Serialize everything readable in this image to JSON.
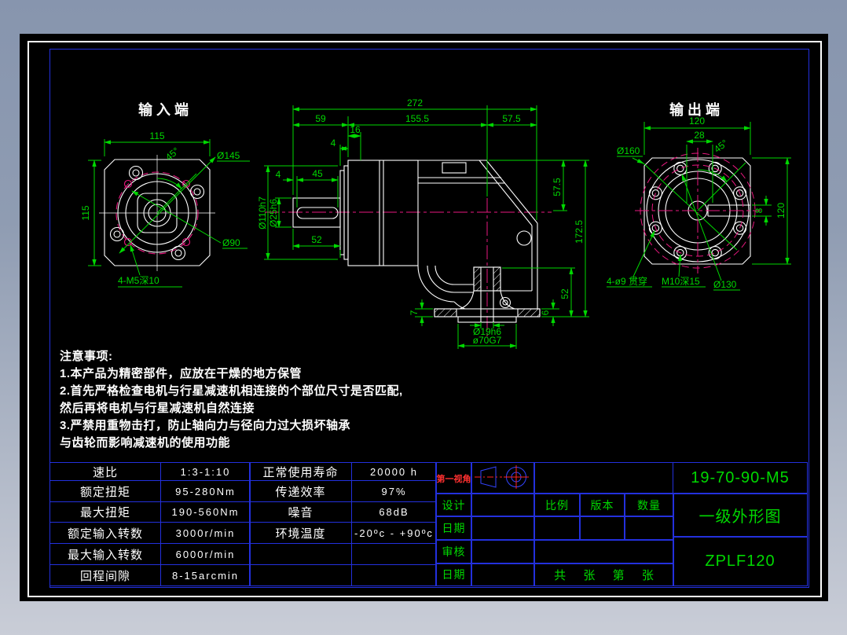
{
  "palette": {
    "bg_top": "#8795ae",
    "bg_bottom": "#c9cdd7",
    "canvas": "#000000",
    "line_white": "#ffffff",
    "dim_green": "#00d800",
    "center_pink": "#e8187f",
    "table_blue": "#2330dd",
    "label_red": "#ff3030",
    "symbol_blue": "#3344ff"
  },
  "views": {
    "input": {
      "title": "输入端",
      "dims": {
        "width": "115",
        "height": "115",
        "angle": "45°",
        "flange_dia": "Ø145",
        "inner_dia": "Ø90",
        "holes": "4-M5深10"
      }
    },
    "side": {
      "dims": {
        "total": "272",
        "seg1": "59",
        "seg2": "155.5",
        "seg3": "57.5",
        "t16": "16",
        "t4a": "4",
        "t4b": "4",
        "t45": "45",
        "shaft_len": "52",
        "flange_dia": "Ø110h7",
        "shaft_dia": "Ø25h6",
        "r57": "57.5",
        "r172": "172.5",
        "r52": "52",
        "b7": "7",
        "b6": "6",
        "out_shaft": "Ø19h6",
        "spigot": "ø70G7"
      }
    },
    "output": {
      "title": "输出端",
      "dims": {
        "width": "120",
        "height": "120",
        "key_len": "28",
        "angle": "45°",
        "flange_dia": "Ø160",
        "bolt_circle": "Ø130",
        "key_w": "8",
        "holes_through": "4-ø9 贯穿",
        "holes_tapped": "M10深15"
      }
    }
  },
  "notes": {
    "title": "注意事项:",
    "lines": [
      "1.本产品为精密部件，应放在干燥的地方保管",
      "2.首先严格检查电机与行星减速机相连接的个部位尺寸是否匹配,",
      "然后再将电机与行星减速机自然连接",
      "3.严禁用重物击打，防止轴向力与径向力过大损坏轴承",
      "与齿轮而影响减速机的使用功能"
    ]
  },
  "spec_table": {
    "left": [
      [
        "速比",
        "1:3-1:10"
      ],
      [
        "额定扭矩",
        "95-280Nm"
      ],
      [
        "最大扭矩",
        "190-560Nm"
      ],
      [
        "额定输入转数",
        "3000r/min"
      ],
      [
        "最大输入转数",
        "6000r/min"
      ],
      [
        "回程间隙",
        "8-15arcmin"
      ]
    ],
    "right": [
      [
        "正常使用寿命",
        "20000 h"
      ],
      [
        "传递效率",
        "97%"
      ],
      [
        "噪音",
        "68dB"
      ],
      [
        "环境温度",
        "-20ºc - +90ºc"
      ],
      [
        "",
        ""
      ],
      [
        "",
        ""
      ]
    ]
  },
  "title_block": {
    "first_angle": "第一视角",
    "design": "设计",
    "date1": "日期",
    "check": "审核",
    "date2": "日期",
    "scale": "比例",
    "version": "版本",
    "qty": "数量",
    "sheet": [
      "共",
      "张",
      "第",
      "张"
    ],
    "model": "19-70-90-M5",
    "drawing_title": "一级外形图",
    "part_no": "ZPLF120"
  }
}
